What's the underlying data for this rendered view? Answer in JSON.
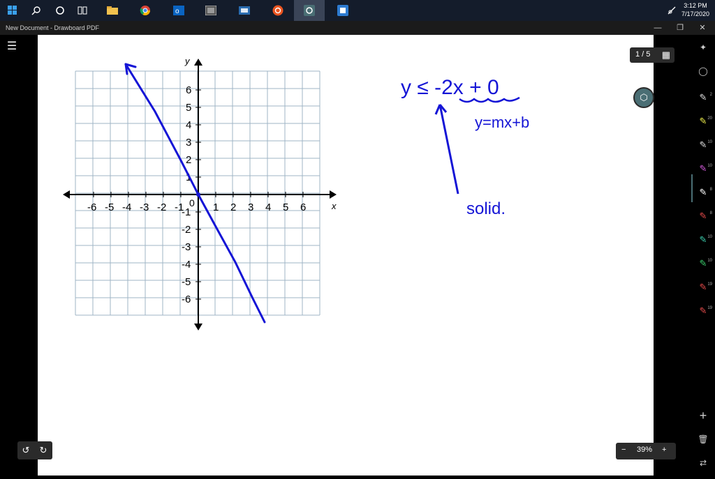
{
  "taskbar": {
    "icons": [
      "windows-start-icon",
      "search-icon",
      "cortana-icon",
      "task-view-icon",
      "file-explorer-icon",
      "chrome-icon",
      "outlook-icon",
      "app-icon",
      "app-icon-2",
      "ubuntu-icon",
      "drawboard-icon",
      "app-icon-3"
    ],
    "time": "3:12 PM",
    "date": "7/17/2020"
  },
  "window": {
    "title": "New Document - Drawboard PDF"
  },
  "page_indicator": {
    "text": "1 / 5"
  },
  "zoom": {
    "value": "39%",
    "minus": "−",
    "plus": "+"
  },
  "right_toolbar": {
    "pen_sizes": [
      "2",
      "20",
      "10",
      "10",
      "8",
      "8",
      "10",
      "10",
      "19",
      "19"
    ]
  },
  "graph": {
    "x_axis_label": "x",
    "y_axis_label": "y",
    "x_ticks": [
      "-6",
      "-5",
      "-4",
      "-3",
      "-2",
      "-1",
      "1",
      "2",
      "3",
      "4",
      "5",
      "6"
    ],
    "y_ticks": [
      "6",
      "5",
      "4",
      "3",
      "2",
      "1",
      "-1",
      "-2",
      "-3",
      "-4",
      "-5",
      "-6"
    ],
    "origin_label": "0"
  },
  "handwriting": {
    "inequality": "y ≤ -2x + 0",
    "form": "y=mx+b",
    "note": "solid."
  },
  "colors": {
    "ink": "#1515d6",
    "canvas": "#ffffff",
    "grid": "#9fb4c6"
  }
}
